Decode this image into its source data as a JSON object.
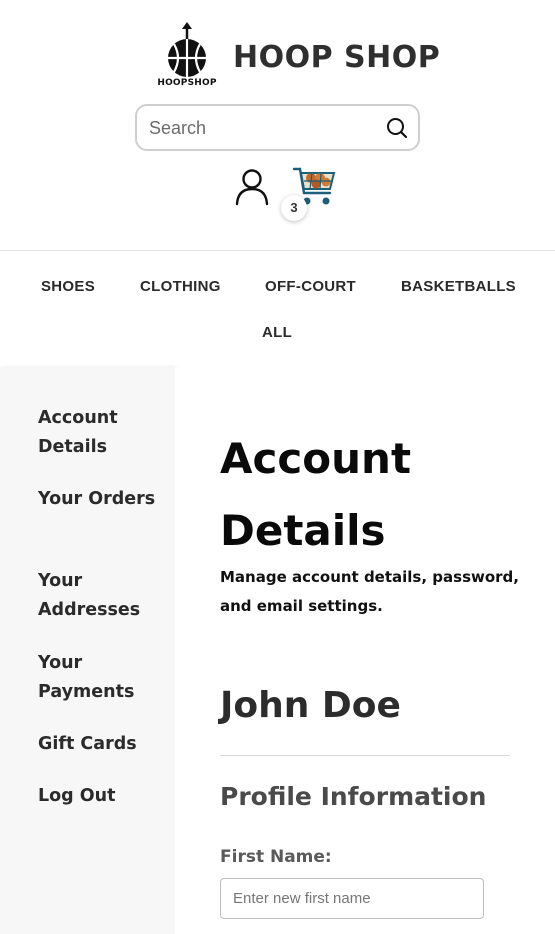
{
  "header": {
    "logo_text": "HOOPSHOP",
    "brand": "HOOP SHOP",
    "search": {
      "placeholder": "Search"
    },
    "cart": {
      "count": "3"
    }
  },
  "nav": {
    "items": [
      {
        "label": "SHOES"
      },
      {
        "label": "CLOTHING"
      },
      {
        "label": "OFF-COURT"
      },
      {
        "label": "BASKETBALLS"
      },
      {
        "label": "ALL"
      }
    ]
  },
  "sidebar": {
    "items": [
      {
        "label": "Account Details"
      },
      {
        "label": "Your Orders"
      },
      {
        "label": "Your Addresses"
      },
      {
        "label": "Your Payments"
      },
      {
        "label": "Gift Cards"
      },
      {
        "label": "Log Out"
      }
    ]
  },
  "main": {
    "title": "Account Details",
    "subtitle": "Manage account details, password, and email settings.",
    "user_name": "John Doe",
    "section_title": "Profile Information",
    "first_name_label": "First Name:",
    "first_name_placeholder": "Enter new first name"
  },
  "icons": {
    "logo": "basketball-logo-icon",
    "search": "search-icon",
    "user": "user-icon",
    "cart": "shopping-cart-icon"
  }
}
